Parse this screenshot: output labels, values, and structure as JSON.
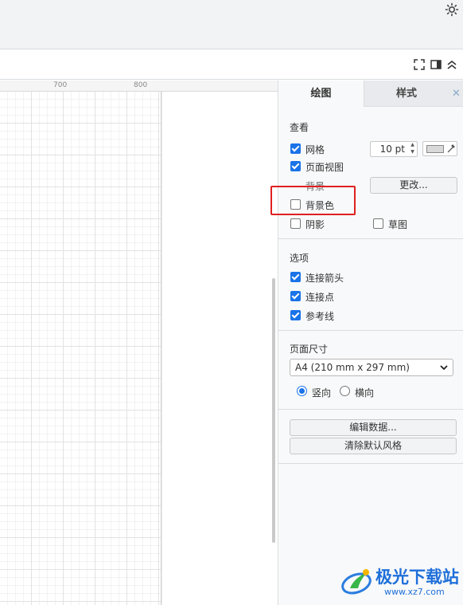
{
  "ruler": {
    "labels": [
      "700",
      "800"
    ]
  },
  "panel": {
    "tabs": {
      "draw": "绘图",
      "style": "样式",
      "close": "✕"
    },
    "view": {
      "title": "查看",
      "grid_label": "网格",
      "grid_checked": true,
      "grid_size": "10 pt",
      "page_view_label": "页面视图",
      "page_view_checked": true,
      "background_label": "背景",
      "change_button": "更改...",
      "background_color_label": "背景色",
      "background_color_checked": false,
      "shadow_label": "阴影",
      "shadow_checked": false,
      "sketch_label": "草图",
      "sketch_checked": false
    },
    "options": {
      "title": "选项",
      "connection_arrows_label": "连接箭头",
      "connection_points_label": "连接点",
      "guides_label": "参考线"
    },
    "page_size": {
      "title": "页面尺寸",
      "selected": "A4 (210 mm x 297 mm)",
      "portrait_label": "竖向",
      "landscape_label": "横向",
      "orientation": "portrait"
    },
    "actions": {
      "edit_data": "编辑数据...",
      "clear_default_style": "清除默认风格"
    }
  },
  "watermark": {
    "name": "极光下载站",
    "url": "www.xz7.com"
  },
  "colors": {
    "accent": "#1a73e8",
    "highlight": "#e02020",
    "watermark": "#1e6fd9"
  }
}
